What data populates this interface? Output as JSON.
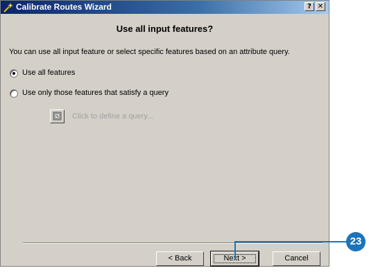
{
  "window": {
    "title": "Calibrate Routes Wizard",
    "title_icon": "wizard-icon",
    "help_label": "?",
    "close_label": "✕"
  },
  "page": {
    "heading": "Use all input features?",
    "description": "You can use all input feature or select specific features based on an attribute query."
  },
  "options": [
    {
      "label": "Use all features",
      "selected": true
    },
    {
      "label": "Use only those features that satisfy a query",
      "selected": false
    }
  ],
  "query": {
    "icon": "query-builder-icon",
    "label": "Click to define a query..."
  },
  "buttons": {
    "back": "< Back",
    "next": "Next >",
    "cancel": "Cancel"
  },
  "callout": {
    "number": "23",
    "color": "#1a75bb"
  }
}
